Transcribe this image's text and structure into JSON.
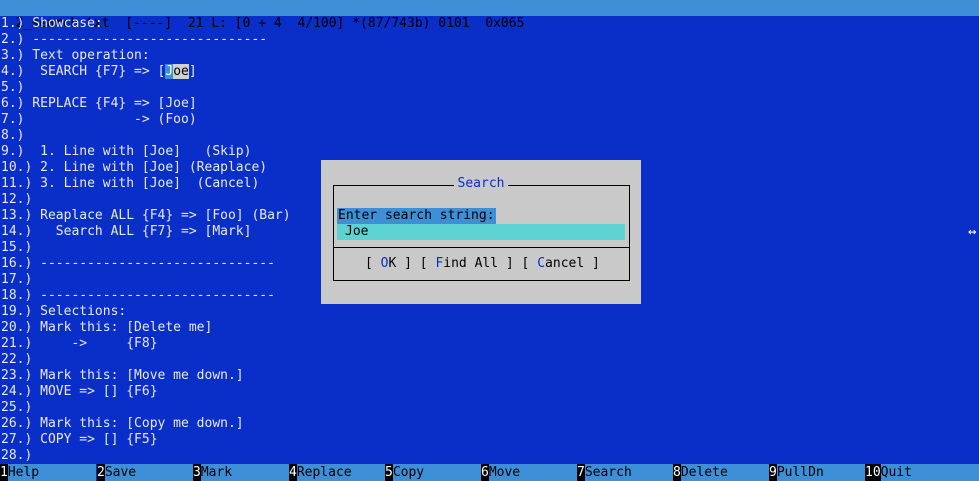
{
  "status_bar": {
    "text": "2_search.txt  [----]  21 L: [0 + 4  4/100] *(87/743b) 0101  0x065"
  },
  "editor": {
    "lines": [
      "1.) Showcase:",
      "2.) ------------------------------",
      "3.) Text operation:",
      "4.)  SEARCH {F7} => [",
      "5.)",
      "6.) REPLACE {F4} => [Joe]",
      "7.)              -> (Foo)",
      "8.)",
      "9.)  1. Line with [Joe]   (Skip)",
      "10.) 2. Line with [Joe] (Reaplace)",
      "11.) 3. Line with [Joe]  (Cancel)",
      "12.)",
      "13.) Reaplace ALL {F4} => [Foo] (Bar)",
      "14.)   Search ALL {F7} => [Mark]",
      "15.)",
      "16.) ------------------------------",
      "17.)",
      "18.) ------------------------------",
      "19.) Selections:",
      "20.) Mark this: [Delete me]",
      "21.)     ->     {F8}",
      "22.)",
      "23.) Mark this: [Move me down.]",
      "24.) MOVE => [] {F6}",
      "25.)",
      "26.) Mark this: [Copy me down.]",
      "27.) COPY => [] {F5}",
      "28.)"
    ],
    "line4_cursor_char": "J",
    "line4_selected": "oe",
    "line4_tail": "]"
  },
  "dialog": {
    "title": "Search",
    "prompt": "Enter search string:",
    "value": "Joe",
    "buttons": {
      "ok_open": "[ ",
      "ok_hot": "O",
      "ok_rest": "K ]",
      "find_open": " [ ",
      "find_hot": "F",
      "find_rest": "ind All ]",
      "cancel_open": " [ ",
      "cancel_hot": "C",
      "cancel_rest": "ancel ]"
    }
  },
  "function_keys": [
    {
      "num": "1",
      "label": "Help"
    },
    {
      "num": "2",
      "label": "Save"
    },
    {
      "num": "3",
      "label": "Mark"
    },
    {
      "num": "4",
      "label": "Replace"
    },
    {
      "num": "5",
      "label": "Copy"
    },
    {
      "num": "6",
      "label": "Move"
    },
    {
      "num": "7",
      "label": "Search"
    },
    {
      "num": "8",
      "label": "Delete"
    },
    {
      "num": "9",
      "label": "PullDn"
    },
    {
      "num": "10",
      "label": "Quit"
    }
  ],
  "colors": {
    "background": "#0a2fc8",
    "bar": "#3d8fd8",
    "dialog": "#c9c9c9",
    "input": "#5ed3d3"
  }
}
